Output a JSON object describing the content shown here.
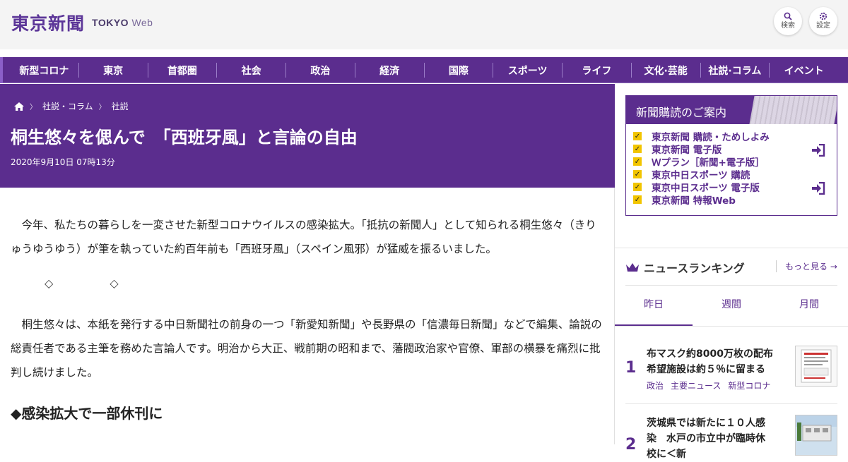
{
  "header": {
    "logo_jp": "東京新聞",
    "logo_en_bold": "TOKYO",
    "logo_en_light": "Web",
    "search_label": "検索",
    "settings_label": "設定"
  },
  "nav": [
    "新型コロナ",
    "東京",
    "首都圏",
    "社会",
    "政治",
    "経済",
    "国際",
    "スポーツ",
    "ライフ",
    "文化·芸能",
    "社説·コラム",
    "イベント"
  ],
  "breadcrumb": {
    "level1": "社説・コラム",
    "level2": "社説"
  },
  "article": {
    "title": "桐生悠々を偲んで　「西班牙風」と言論の自由",
    "date": "2020年9月10日 07時13分",
    "p1": "今年、私たちの暮らしを一変させた新型コロナウイルスの感染拡大。「抵抗の新聞人」として知られる桐生悠々（きりゅうゆうゆう）が筆を執っていた約百年前も「西班牙風」（スペイン風邪）が猛威を振るいました。",
    "diamond": "◇",
    "p2": "桐生悠々は、本紙を発行する中日新聞社の前身の一つ「新愛知新聞」や長野県の「信濃毎日新聞」などで編集、論説の総責任者である主筆を務めた言論人です。明治から大正、戦前期の昭和まで、藩閥政治家や官僚、軍部の横暴を痛烈に批判し続けました。",
    "heading": "◆感染拡大で一部休刊に"
  },
  "subscription": {
    "title": "新聞購読のご案内",
    "items": [
      "東京新聞 購読・ためしよみ",
      "東京新聞 電子版",
      "Ｗプラン［新聞+電子版］",
      "東京中日スポーツ 購読",
      "東京中日スポーツ 電子版",
      "東京新聞 特報Web"
    ]
  },
  "ranking": {
    "title": "ニュースランキング",
    "more": "もっと見る",
    "tabs": [
      "昨日",
      "週間",
      "月間"
    ],
    "items": [
      {
        "rank": "1",
        "text": "布マスク約8000万枚の配布　希望施設は約５％に留まる",
        "tags": [
          "政治",
          "主要ニュース",
          "新型コロナ"
        ]
      },
      {
        "rank": "2",
        "text": "茨城県では新たに１０人感染　水戸の市立中が臨時休校に＜新"
      }
    ]
  },
  "colors": {
    "brand": "#5b2d8e",
    "check": "#f2c500"
  }
}
